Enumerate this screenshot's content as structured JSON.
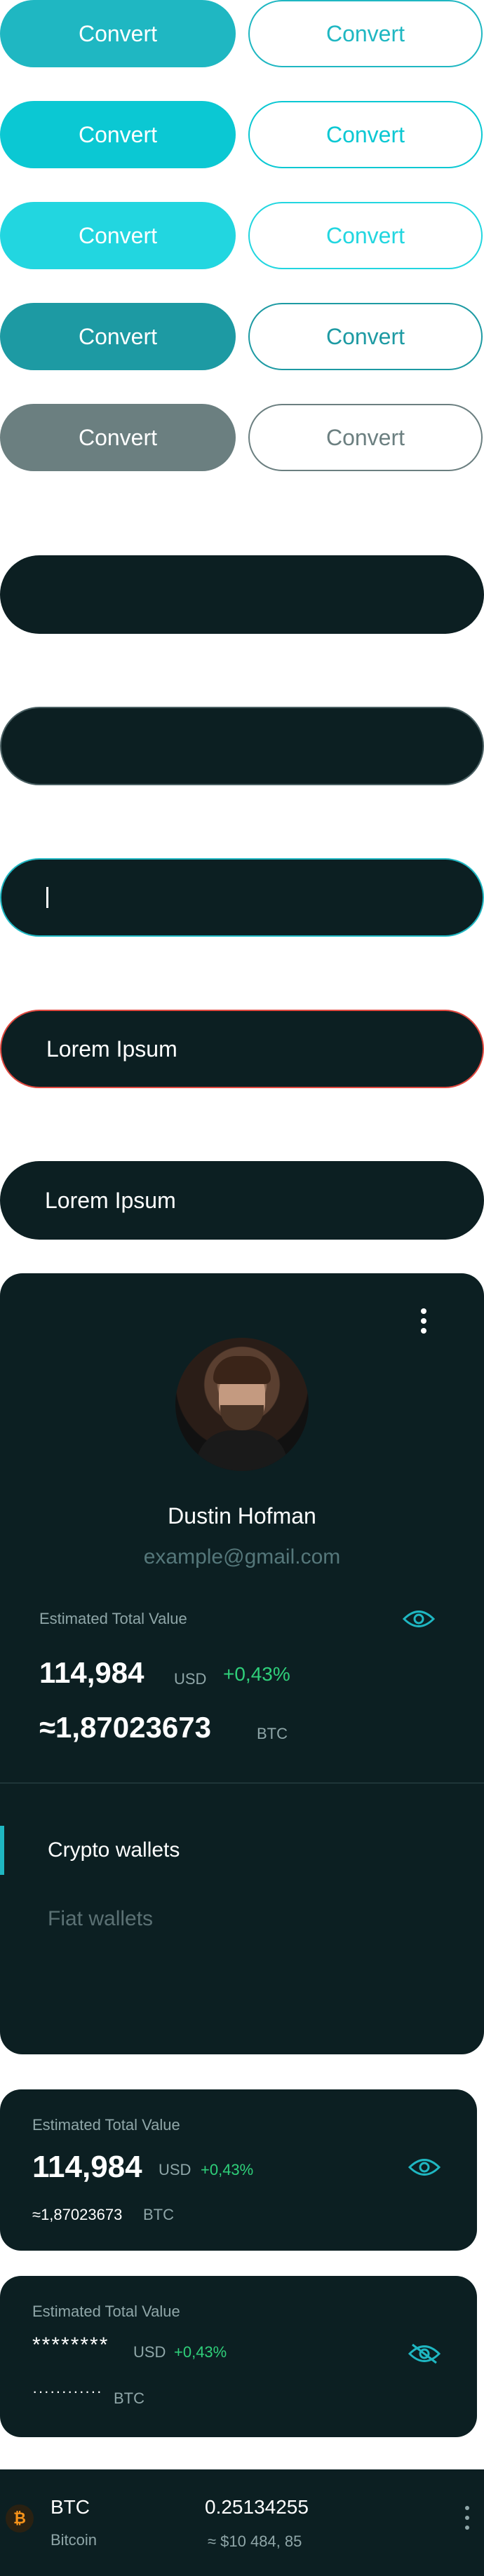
{
  "buttons": {
    "label": "Convert",
    "rows": [
      {
        "fill": "#1fb7c2",
        "outline": "#1fb7c2",
        "text": "#1fb7c2"
      },
      {
        "fill": "#0bc8d3",
        "outline": "#0bc8d3",
        "text": "#0bc8d3"
      },
      {
        "fill": "#22d6e0",
        "outline": "#22d6e0",
        "text": "#22d6e0"
      },
      {
        "fill": "#1d9aa3",
        "outline": "#1d9aa3",
        "text": "#1d9aa3"
      },
      {
        "fill": "#6b7f80",
        "outline": "#6b7f80",
        "text": "#6b7f80"
      }
    ]
  },
  "fields": {
    "empty_1": "",
    "empty_2": "",
    "focused": "",
    "error_value": "Lorem Ipsum",
    "filled_value": "Lorem Ipsum"
  },
  "profile": {
    "name": "Dustin Hofman",
    "email": "example@gmail.com",
    "estimated_label": "Estimated Total Value",
    "usd_value": "114,984",
    "usd_unit": "USD",
    "change": "+0,43%",
    "btc_value": "≈1,87023673",
    "btc_unit": "BTC",
    "menu": [
      "Crypto wallets",
      "Fiat wallets"
    ]
  },
  "summary_card": {
    "label": "Estimated Total Value",
    "usd_value": "114,984",
    "usd_unit": "USD",
    "change": "+0,43%",
    "btc_value": "≈1,87023673",
    "btc_unit": "BTC"
  },
  "hidden_card": {
    "label": "Estimated Total Value",
    "usd_masked": "********",
    "usd_unit": "USD",
    "change": "+0,43%",
    "btc_masked": "············",
    "btc_unit": "BTC"
  },
  "asset_row": {
    "symbol": "BTC",
    "name": "Bitcoin",
    "amount": "0.25134255",
    "fiat": "≈ $10 484, 85"
  },
  "colors": {
    "dark_bg": "#0c1f22",
    "accent": "#1fb7c2",
    "positive": "#2fd07a",
    "error": "#e0483f"
  }
}
